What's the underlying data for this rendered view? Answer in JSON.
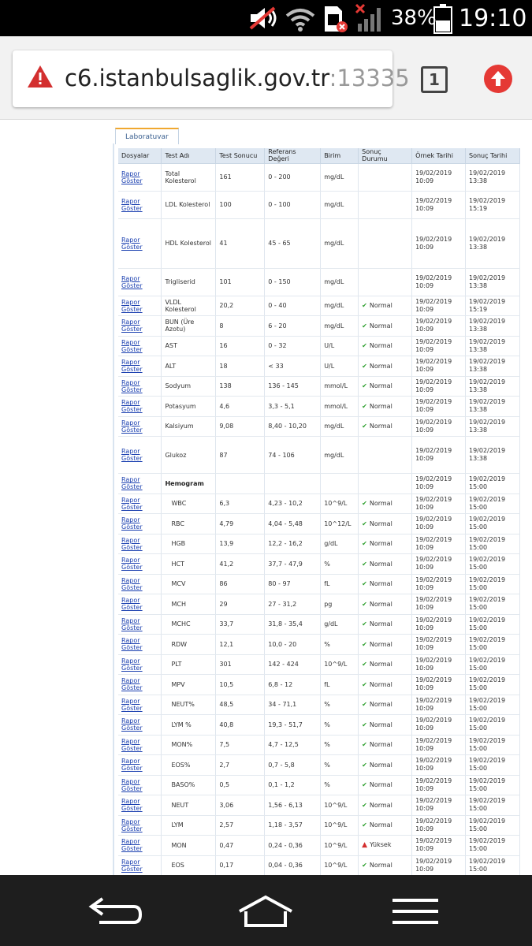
{
  "status_bar": {
    "battery": "38%",
    "time": "19:10",
    "icons": [
      "mute-icon",
      "wifi-icon",
      "sim-error-icon",
      "no-signal-icon",
      "battery-icon"
    ]
  },
  "browser": {
    "url_host": "c6.istanbulsaglik.gov.tr",
    "url_port": ":13335",
    "tab_count": "1",
    "icons": [
      "warning-icon",
      "tabs-icon",
      "update-icon"
    ]
  },
  "lab_tab": "Laboratuvar",
  "table": {
    "headers": [
      "Dosyalar",
      "Test Adı",
      "Test Sonucu",
      "Referans Değeri",
      "Birim",
      "Sonuç Durumu",
      "Örnek Tarihi",
      "Sonuç Tarihi"
    ],
    "link_label": "Rapor Göster",
    "rows": [
      {
        "name": "Total Kolesterol",
        "result": "161",
        "ref": "0 - 200",
        "unit": "mg/dL",
        "status": "",
        "sample_date": "19/02/2019",
        "sample_time": "10:09",
        "result_date": "19/02/2019",
        "result_time": "13:38"
      },
      {
        "name": "LDL Kolesterol",
        "result": "100",
        "ref": "0 - 100",
        "unit": "mg/dL",
        "status": "",
        "sample_date": "19/02/2019",
        "sample_time": "10:09",
        "result_date": "19/02/2019",
        "result_time": "15:19"
      },
      {
        "name": "HDL Kolesterol",
        "result": "41",
        "ref": "45 - 65",
        "unit": "mg/dL",
        "status": "",
        "sample_date": "19/02/2019",
        "sample_time": "10:09",
        "result_date": "19/02/2019",
        "result_time": "13:38"
      },
      {
        "name": "Trigliserid",
        "result": "101",
        "ref": "0 - 150",
        "unit": "mg/dL",
        "status": "",
        "sample_date": "19/02/2019",
        "sample_time": "10:09",
        "result_date": "19/02/2019",
        "result_time": "13:38"
      },
      {
        "name": "VLDL Kolesterol",
        "result": "20,2",
        "ref": "0 - 40",
        "unit": "mg/dL",
        "status": "Normal",
        "sample_date": "19/02/2019",
        "sample_time": "10:09",
        "result_date": "19/02/2019",
        "result_time": "15:19"
      },
      {
        "name": "BUN (Üre Azotu)",
        "result": "8",
        "ref": "6 - 20",
        "unit": "mg/dL",
        "status": "Normal",
        "sample_date": "19/02/2019",
        "sample_time": "10:09",
        "result_date": "19/02/2019",
        "result_time": "13:38"
      },
      {
        "name": "AST",
        "result": "16",
        "ref": "0 - 32",
        "unit": "U/L",
        "status": "Normal",
        "sample_date": "19/02/2019",
        "sample_time": "10:09",
        "result_date": "19/02/2019",
        "result_time": "13:38"
      },
      {
        "name": "ALT",
        "result": "18",
        "ref": "< 33",
        "unit": "U/L",
        "status": "Normal",
        "sample_date": "19/02/2019",
        "sample_time": "10:09",
        "result_date": "19/02/2019",
        "result_time": "13:38"
      },
      {
        "name": "Sodyum",
        "result": "138",
        "ref": "136 - 145",
        "unit": "mmol/L",
        "status": "Normal",
        "sample_date": "19/02/2019",
        "sample_time": "10:09",
        "result_date": "19/02/2019",
        "result_time": "13:38"
      },
      {
        "name": "Potasyum",
        "result": "4,6",
        "ref": "3,3 - 5,1",
        "unit": "mmol/L",
        "status": "Normal",
        "sample_date": "19/02/2019",
        "sample_time": "10:09",
        "result_date": "19/02/2019",
        "result_time": "13:38"
      },
      {
        "name": "Kalsiyum",
        "result": "9,08",
        "ref": "8,40 - 10,20",
        "unit": "mg/dL",
        "status": "Normal",
        "sample_date": "19/02/2019",
        "sample_time": "10:09",
        "result_date": "19/02/2019",
        "result_time": "13:38"
      },
      {
        "name": "Glukoz",
        "result": "87",
        "ref": "74 - 106",
        "unit": "mg/dL",
        "status": "",
        "sample_date": "19/02/2019",
        "sample_time": "10:09",
        "result_date": "19/02/2019",
        "result_time": "13:38"
      },
      {
        "name": "Hemogram",
        "result": "",
        "ref": "",
        "unit": "",
        "status": "",
        "sample_date": "19/02/2019",
        "sample_time": "10:09",
        "result_date": "19/02/2019",
        "result_time": "15:00",
        "group": true
      },
      {
        "name": "WBC",
        "result": "6,3",
        "ref": "4,23 - 10,2",
        "unit": "10^9/L",
        "status": "Normal",
        "sample_date": "19/02/2019",
        "sample_time": "10:09",
        "result_date": "19/02/2019",
        "result_time": "15:00",
        "sub": true
      },
      {
        "name": "RBC",
        "result": "4,79",
        "ref": "4,04 - 5,48",
        "unit": "10^12/L",
        "status": "Normal",
        "sample_date": "19/02/2019",
        "sample_time": "10:09",
        "result_date": "19/02/2019",
        "result_time": "15:00",
        "sub": true
      },
      {
        "name": "HGB",
        "result": "13,9",
        "ref": "12,2 - 16,2",
        "unit": "g/dL",
        "status": "Normal",
        "sample_date": "19/02/2019",
        "sample_time": "10:09",
        "result_date": "19/02/2019",
        "result_time": "15:00",
        "sub": true
      },
      {
        "name": "HCT",
        "result": "41,2",
        "ref": "37,7 - 47,9",
        "unit": "%",
        "status": "Normal",
        "sample_date": "19/02/2019",
        "sample_time": "10:09",
        "result_date": "19/02/2019",
        "result_time": "15:00",
        "sub": true
      },
      {
        "name": "MCV",
        "result": "86",
        "ref": "80 - 97",
        "unit": "fL",
        "status": "Normal",
        "sample_date": "19/02/2019",
        "sample_time": "10:09",
        "result_date": "19/02/2019",
        "result_time": "15:00",
        "sub": true
      },
      {
        "name": "MCH",
        "result": "29",
        "ref": "27 - 31,2",
        "unit": "pg",
        "status": "Normal",
        "sample_date": "19/02/2019",
        "sample_time": "10:09",
        "result_date": "19/02/2019",
        "result_time": "15:00",
        "sub": true
      },
      {
        "name": "MCHC",
        "result": "33,7",
        "ref": "31,8 - 35,4",
        "unit": "g/dL",
        "status": "Normal",
        "sample_date": "19/02/2019",
        "sample_time": "10:09",
        "result_date": "19/02/2019",
        "result_time": "15:00",
        "sub": true
      },
      {
        "name": "RDW",
        "result": "12,1",
        "ref": "10,0 - 20",
        "unit": "%",
        "status": "Normal",
        "sample_date": "19/02/2019",
        "sample_time": "10:09",
        "result_date": "19/02/2019",
        "result_time": "15:00",
        "sub": true
      },
      {
        "name": "PLT",
        "result": "301",
        "ref": "142 - 424",
        "unit": "10^9/L",
        "status": "Normal",
        "sample_date": "19/02/2019",
        "sample_time": "10:09",
        "result_date": "19/02/2019",
        "result_time": "15:00",
        "sub": true
      },
      {
        "name": "MPV",
        "result": "10,5",
        "ref": "6,8 - 12",
        "unit": "fL",
        "status": "Normal",
        "sample_date": "19/02/2019",
        "sample_time": "10:09",
        "result_date": "19/02/2019",
        "result_time": "15:00",
        "sub": true
      },
      {
        "name": "NEUT%",
        "result": "48,5",
        "ref": "34 - 71,1",
        "unit": "%",
        "status": "Normal",
        "sample_date": "19/02/2019",
        "sample_time": "10:09",
        "result_date": "19/02/2019",
        "result_time": "15:00",
        "sub": true
      },
      {
        "name": "LYM %",
        "result": "40,8",
        "ref": "19,3 - 51,7",
        "unit": "%",
        "status": "Normal",
        "sample_date": "19/02/2019",
        "sample_time": "10:09",
        "result_date": "19/02/2019",
        "result_time": "15:00",
        "sub": true
      },
      {
        "name": "MON%",
        "result": "7,5",
        "ref": "4,7 - 12,5",
        "unit": "%",
        "status": "Normal",
        "sample_date": "19/02/2019",
        "sample_time": "10:09",
        "result_date": "19/02/2019",
        "result_time": "15:00",
        "sub": true
      },
      {
        "name": "EOS%",
        "result": "2,7",
        "ref": "0,7 - 5,8",
        "unit": "%",
        "status": "Normal",
        "sample_date": "19/02/2019",
        "sample_time": "10:09",
        "result_date": "19/02/2019",
        "result_time": "15:00",
        "sub": true
      },
      {
        "name": "BASO%",
        "result": "0,5",
        "ref": "0,1 - 1,2",
        "unit": "%",
        "status": "Normal",
        "sample_date": "19/02/2019",
        "sample_time": "10:09",
        "result_date": "19/02/2019",
        "result_time": "15:00",
        "sub": true
      },
      {
        "name": "NEUT",
        "result": "3,06",
        "ref": "1,56 - 6,13",
        "unit": "10^9/L",
        "status": "Normal",
        "sample_date": "19/02/2019",
        "sample_time": "10:09",
        "result_date": "19/02/2019",
        "result_time": "15:00",
        "sub": true
      },
      {
        "name": "LYM",
        "result": "2,57",
        "ref": "1,18 - 3,57",
        "unit": "10^9/L",
        "status": "Normal",
        "sample_date": "19/02/2019",
        "sample_time": "10:09",
        "result_date": "19/02/2019",
        "result_time": "15:00",
        "sub": true
      },
      {
        "name": "MON",
        "result": "0,47",
        "ref": "0,24 - 0,36",
        "unit": "10^9/L",
        "status": "Yüksek",
        "sample_date": "19/02/2019",
        "sample_time": "10:09",
        "result_date": "19/02/2019",
        "result_time": "15:00",
        "sub": true
      },
      {
        "name": "EOS",
        "result": "0,17",
        "ref": "0,04 - 0,36",
        "unit": "10^9/L",
        "status": "Normal",
        "sample_date": "19/02/2019",
        "sample_time": "10:09",
        "result_date": "19/02/2019",
        "result_time": "15:00",
        "sub": true
      }
    ]
  },
  "nav_bar": {
    "icons": [
      "back-icon",
      "home-icon",
      "menu-icon"
    ]
  },
  "colors": {
    "link": "#1a3fb0",
    "normal": "#2fa02f",
    "high": "#d32f2f",
    "header_bg": "#dfe8f2",
    "warning": "#d32f2f",
    "update": "#e53935"
  }
}
